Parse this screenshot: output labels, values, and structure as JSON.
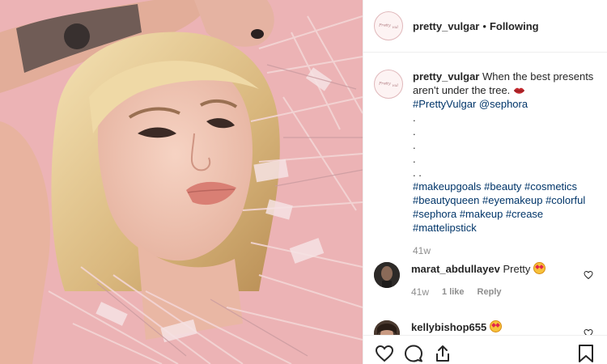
{
  "post": {
    "username": "pretty_vulgar",
    "separator": "•",
    "follow_status": "Following",
    "avatar_text": "ᴾʳᵉᵗᵗʸ ᵥᵤₗ"
  },
  "caption": {
    "username": "pretty_vulgar",
    "text": "When the best presents aren't under the tree.",
    "lips_emoji": "lips-icon",
    "line2_tag": "#PrettyVulgar",
    "line2_mention": "@sephora",
    "dots": [
      ".",
      ".",
      ".",
      ".",
      ". ."
    ],
    "hashtags_line1": "#makeupgoals #beauty #cosmetics",
    "hashtags_line2": "#beautyqueen #eyemakeup #colorful",
    "hashtags_line3": "#sephora #makeup #crease",
    "hashtags_line4": "#mattelipstick",
    "time": "41w"
  },
  "comments": [
    {
      "username": "marat_abdullayev",
      "text": "Pretty",
      "emoji": "star-struck-icon",
      "time": "41w",
      "likes": "1 like",
      "reply": "Reply"
    },
    {
      "username": "kellybishop655",
      "text": "",
      "emoji": "star-struck-icon"
    }
  ],
  "actions": {
    "like": "heart-icon",
    "comment": "comment-icon",
    "share": "share-icon",
    "save": "bookmark-icon"
  },
  "colors": {
    "link": "#003569",
    "muted": "#8e8e8e",
    "text": "#262626",
    "photo_bg": "#e8a6aa"
  }
}
